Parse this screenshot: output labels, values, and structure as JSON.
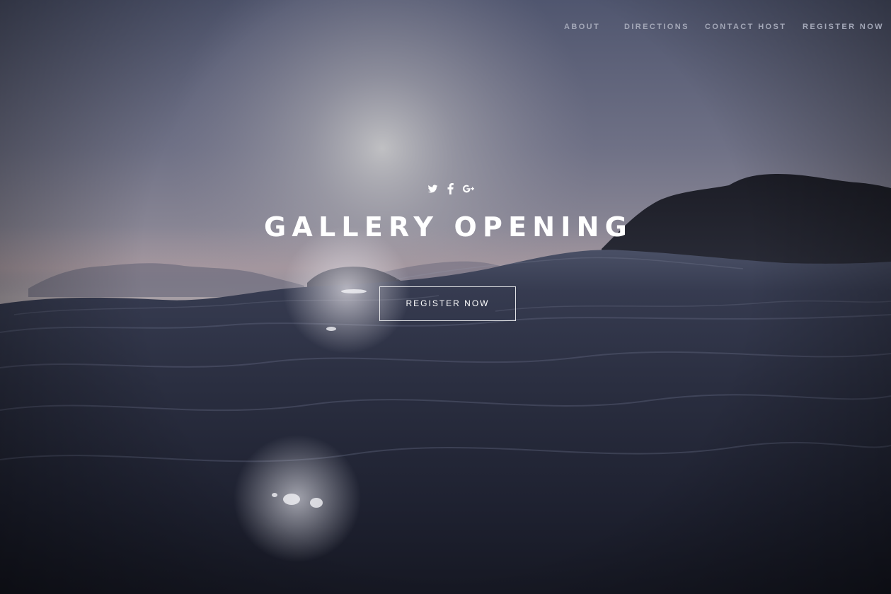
{
  "nav": {
    "items": [
      {
        "label": "ABOUT"
      },
      {
        "label": "DIRECTIONS"
      },
      {
        "label": "CONTACT HOST"
      },
      {
        "label": "REGISTER NOW"
      }
    ]
  },
  "social": {
    "icons": [
      "twitter-icon",
      "facebook-icon",
      "google-plus-icon"
    ]
  },
  "hero": {
    "title": "GALLERY OPENING",
    "cta_label": "REGISTER NOW",
    "background": "ocean-waves-dusk-photo"
  },
  "colors": {
    "sky_top": "#5b6079",
    "sky_glow": "#b9b9bd",
    "water_dark": "#1b1e2c",
    "text": "#ffffff",
    "nav_text": "#a4a8b8"
  }
}
